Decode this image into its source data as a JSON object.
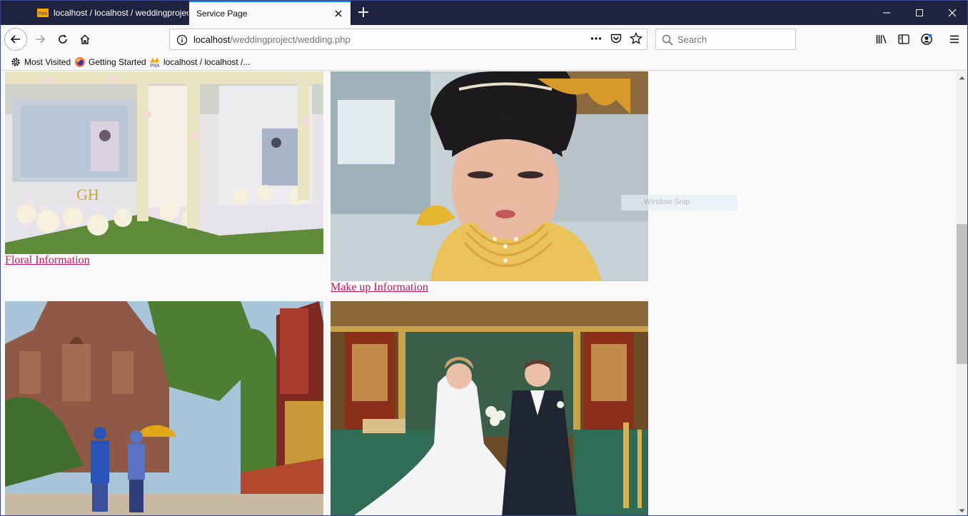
{
  "tabs": [
    {
      "title": "localhost / localhost / weddingproject",
      "active": false
    },
    {
      "title": "Service Page",
      "active": true
    }
  ],
  "window_controls": {
    "minimize": "─",
    "maximize": "☐",
    "close": "✕"
  },
  "new_tab_label": "+",
  "url": {
    "host": "localhost",
    "path": "/weddingproject/wedding.php"
  },
  "search": {
    "placeholder": "Search"
  },
  "bookmarks": [
    {
      "label": "Most Visited",
      "icon": "gear-icon"
    },
    {
      "label": "Getting Started",
      "icon": "firefox-icon"
    },
    {
      "label": "localhost / localhost /...",
      "icon": "pma-icon"
    }
  ],
  "services": [
    {
      "label": "Floral Information",
      "image": "floral-stage-photo"
    },
    {
      "label": "Make up Information",
      "image": "bride-makeup-photo"
    },
    {
      "label": "",
      "image": "temple-couple-photo"
    },
    {
      "label": "",
      "image": "church-couple-photo"
    }
  ],
  "overlay_text": "Window Snip",
  "colors": {
    "tabstrip": "#202340",
    "link": "#c2185b",
    "accent": "#0a84ff"
  }
}
